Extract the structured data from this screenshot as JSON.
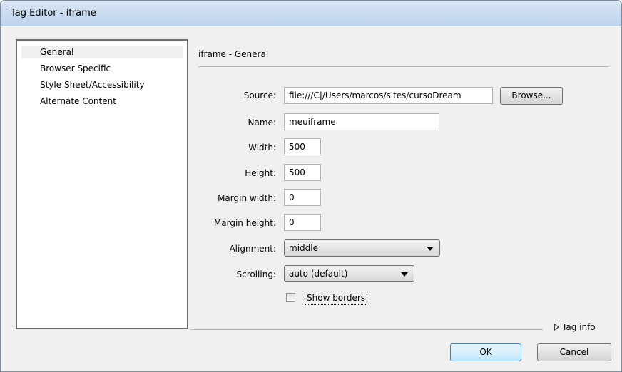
{
  "window": {
    "title": "Tag Editor - iframe"
  },
  "sidebar": {
    "items": [
      {
        "label": "General",
        "selected": true
      },
      {
        "label": "Browser Specific",
        "selected": false
      },
      {
        "label": "Style Sheet/Accessibility",
        "selected": false
      },
      {
        "label": "Alternate Content",
        "selected": false
      }
    ]
  },
  "panel": {
    "title": "iframe - General",
    "fields": {
      "source": {
        "label": "Source:",
        "value": "file:///C|/Users/marcos/sites/cursoDream"
      },
      "name": {
        "label": "Name:",
        "value": "meuiframe"
      },
      "width": {
        "label": "Width:",
        "value": "500"
      },
      "height": {
        "label": "Height:",
        "value": "500"
      },
      "margin_width": {
        "label": "Margin width:",
        "value": "0"
      },
      "margin_height": {
        "label": "Margin height:",
        "value": "0"
      },
      "alignment": {
        "label": "Alignment:",
        "value": "middle"
      },
      "scrolling": {
        "label": "Scrolling:",
        "value": "auto (default)"
      }
    },
    "browse_label": "Browse...",
    "show_borders": {
      "label": "Show borders",
      "checked": false
    }
  },
  "tag_info_label": "Tag info",
  "buttons": {
    "ok": "OK",
    "cancel": "Cancel"
  },
  "colors": {
    "titlebar": "#c9dcf1",
    "sidebar_selected": "#f0f0f0",
    "dialog_bg": "#f0f0f0"
  }
}
